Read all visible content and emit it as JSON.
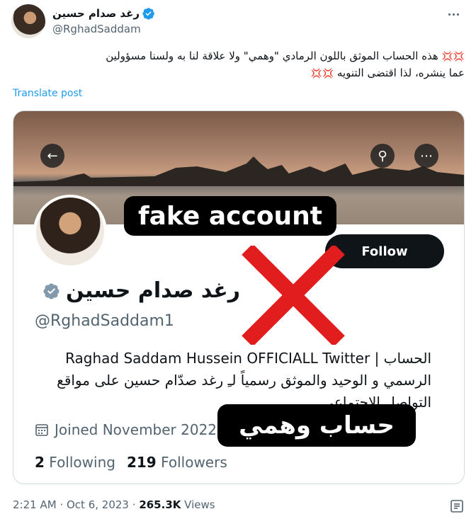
{
  "author": {
    "name": "رغد صدام حسين",
    "handle": "@RghadSaddam"
  },
  "tweet": {
    "line1": "هذه الحساب الموثق باللون الرمادي \"وهمي\" ولا علاقة لنا به ولسنا مسؤولين",
    "line2": "عما ينشره، لذا اقتضى التنويه",
    "emoji": "💢💢"
  },
  "translate_label": "Translate post",
  "embedded_profile": {
    "name": "رغد صدام حسين",
    "handle": "@RghadSaddam1",
    "follow_label": "Follow",
    "bio_line1": "الحساب | Raghad Saddam Hussein OFFICIALL Twitter",
    "bio_line2": "الرسمي و الوحيد والموثق رسمياً لـِ رغد صدّام حسين على مواقع",
    "bio_line3": "التواصل الاجتماعي",
    "joined": "Joined November 2022",
    "following_count": "2",
    "following_label": "Following",
    "followers_count": "219",
    "followers_label": "Followers",
    "fake_label_en": "fake account",
    "fake_label_ar": "حساب وهمي"
  },
  "meta": {
    "time": "2:21 AM",
    "separator": "·",
    "date": "Oct 6, 2023",
    "views_count": "265.3K",
    "views_label": "Views"
  },
  "colors": {
    "link": "#1d9bf0",
    "verified": "#1d9bf0",
    "secondary_text": "#536471",
    "cross": "#e11d1d"
  }
}
